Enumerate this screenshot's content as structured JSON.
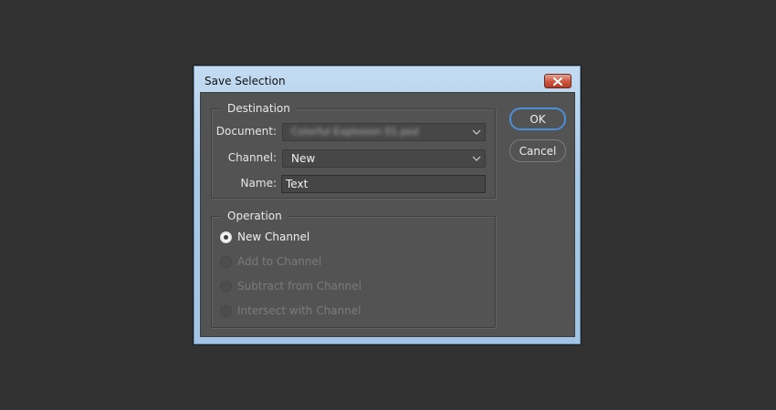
{
  "dialog": {
    "title": "Save Selection",
    "close_icon": "close-x-icon",
    "colors": {
      "background": "#323232",
      "client": "#535353",
      "title_bar": "#a9c9e8",
      "default_button_border": "#4b8fd9",
      "close_button": "#cd5a44"
    }
  },
  "destination": {
    "legend": "Destination",
    "document": {
      "label": "Document:",
      "value": "Colorful Explosion 01.psd"
    },
    "channel": {
      "label": "Channel:",
      "value": "New"
    },
    "name": {
      "label": "Name:",
      "value": "Text"
    }
  },
  "operation": {
    "legend": "Operation",
    "options": [
      {
        "label": "New Channel",
        "checked": true,
        "enabled": true
      },
      {
        "label": "Add to Channel",
        "checked": false,
        "enabled": false
      },
      {
        "label": "Subtract from Channel",
        "checked": false,
        "enabled": false
      },
      {
        "label": "Intersect with Channel",
        "checked": false,
        "enabled": false
      }
    ]
  },
  "buttons": {
    "ok": "OK",
    "cancel": "Cancel"
  }
}
